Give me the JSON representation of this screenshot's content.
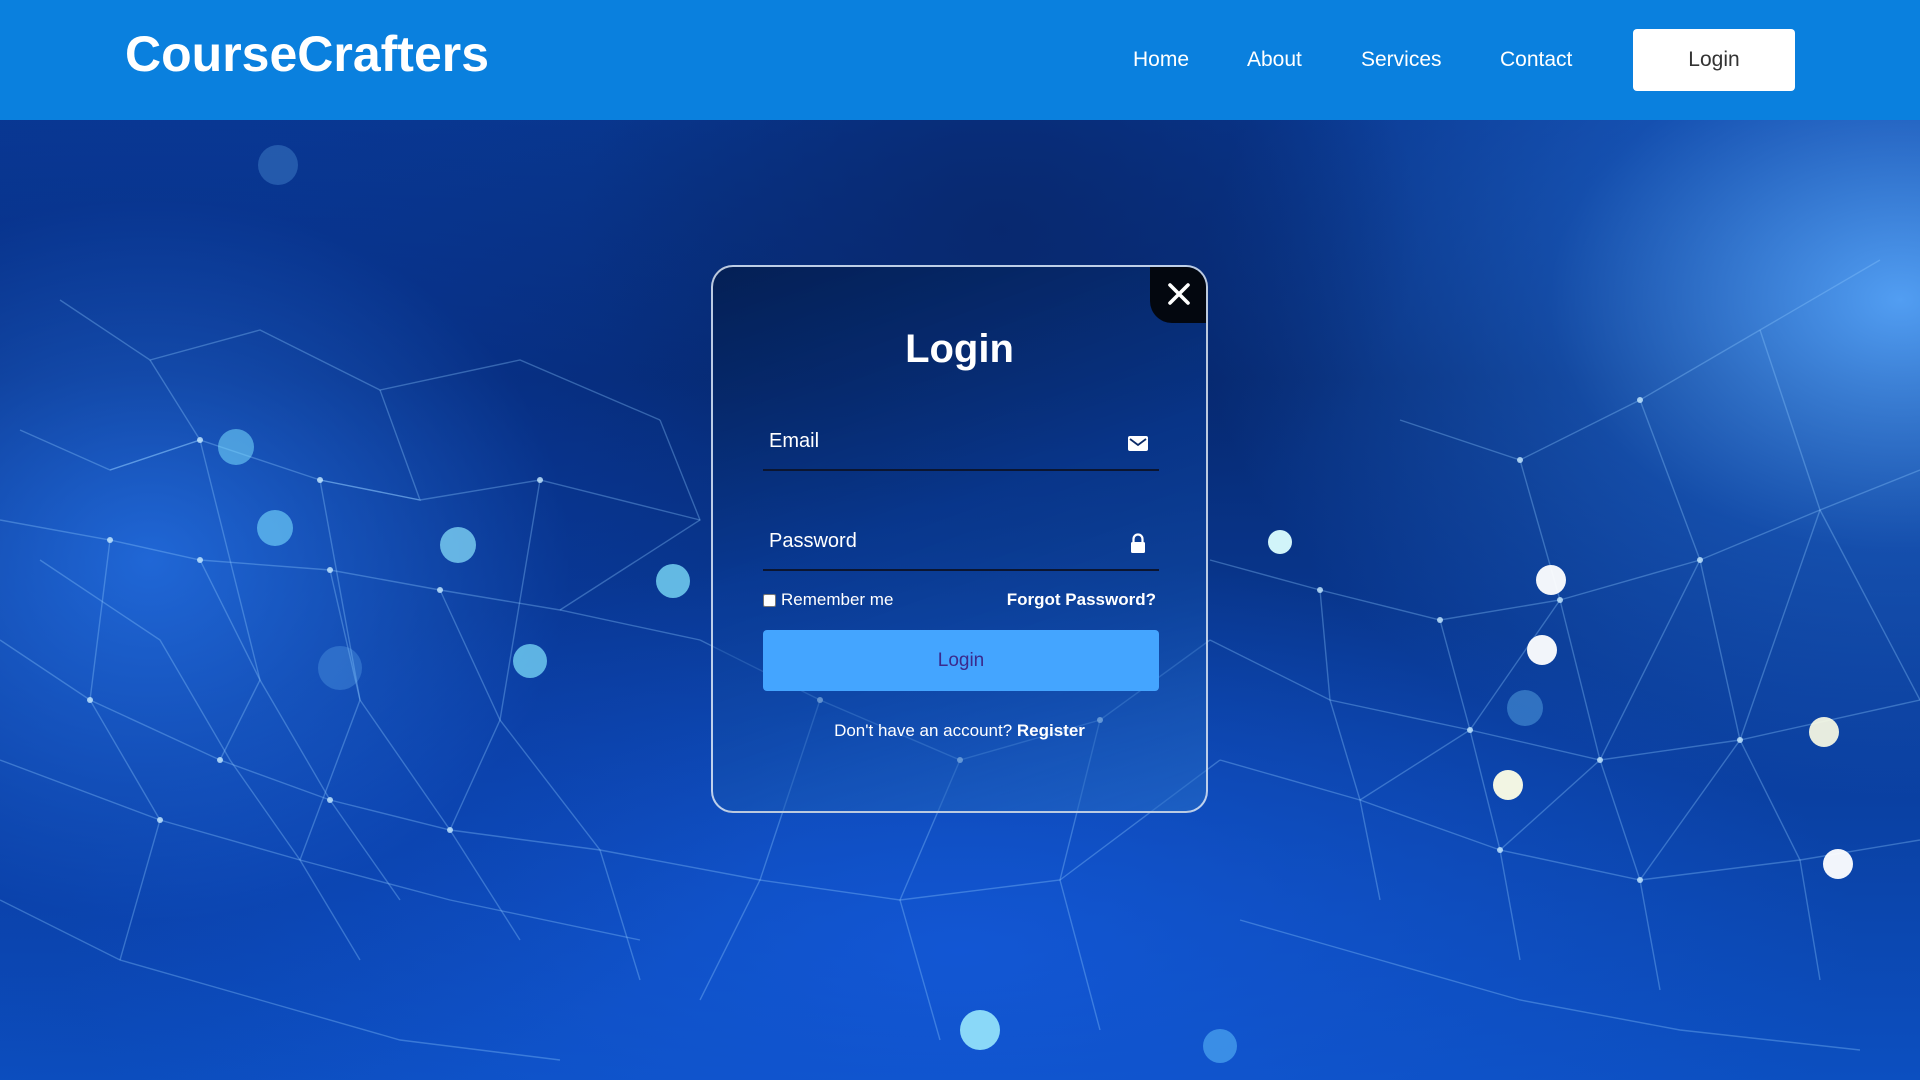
{
  "header": {
    "logo": "CourseCrafters",
    "nav": [
      {
        "label": "Home"
      },
      {
        "label": "About"
      },
      {
        "label": "Services"
      },
      {
        "label": "Contact"
      }
    ],
    "login_button": "Login",
    "background_color": "#0a80de"
  },
  "modal": {
    "title": "Login",
    "email": {
      "placeholder": "Email",
      "value": "",
      "icon": "envelope-icon"
    },
    "password": {
      "placeholder": "Password",
      "value": "",
      "icon": "lock-icon"
    },
    "remember_label": "Remember me",
    "remember_checked": false,
    "forgot_label": "Forgot Password?",
    "submit_label": "Login",
    "submit_color": "#44a5ff",
    "register_prompt": "Don't have an account?",
    "register_link": "Register",
    "close_icon": "close-icon"
  }
}
